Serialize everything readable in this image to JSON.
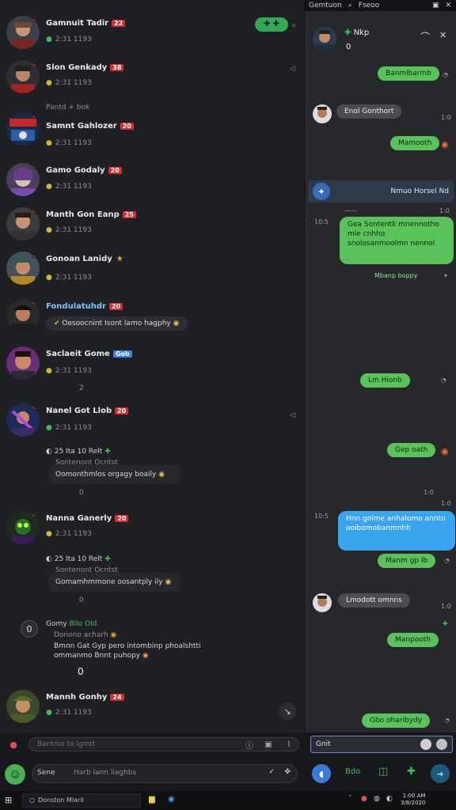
{
  "topbar": {
    "item1": "Gemtuon",
    "item2": "Fseoo"
  },
  "left_list": {
    "rows": [
      {
        "name": "Gamnuit Tadir",
        "badge": "22",
        "sub_icon": "●",
        "sub": "2:31  1193"
      },
      {
        "name": "Slon Genkady",
        "badge": "38",
        "sub_icon": "●",
        "sub": "2:31  1193"
      },
      {
        "name": "Samnt Gahlozer",
        "badge": "20",
        "pre": "Pantd + bok",
        "sub_icon": "●",
        "sub": "2:31  1193"
      },
      {
        "name": "Gamo Godaly",
        "badge": "20",
        "sub_icon": "●",
        "sub": "2:31  1193"
      },
      {
        "name": "Manth Gon Eanp",
        "badge": "25",
        "sub_icon": "●",
        "sub": "2:31  1193"
      },
      {
        "name": "Gonoan Lanidy",
        "sub_icon": "●",
        "sub": "2:31  1193"
      },
      {
        "name": "Fondulatuhdr",
        "badge": "20",
        "pill": "Oesoocnint Isont lamo hagphy"
      },
      {
        "name": "Saclaeit Gome",
        "badge_blue": "Gob",
        "sub_icon": "●",
        "sub": "2:31  1193",
        "extra": "2"
      },
      {
        "name": "Nanel Got Llob",
        "badge": "20",
        "sub_icon": "●",
        "sub": "2:31  1193"
      },
      {
        "name": "Nanna Ganerly",
        "badge": "20",
        "sub_icon": "●",
        "sub": "2:31  1193"
      },
      {
        "name": "Mannh Gonhy",
        "badge": "24",
        "sub_icon": "●",
        "sub": "2:31  1193"
      }
    ],
    "quote1": {
      "meta": "25 Ita 10 Relt",
      "sub": "Sontenont Ocntst",
      "text": "Oomonthmlos orgagy boaily"
    },
    "quote2": {
      "meta": "25 Ita 10 Relt",
      "sub": "Sontenont Ocntst",
      "text": "Gomamhmmone oosantply ily"
    },
    "note": {
      "label": "Gomy",
      "tag": "Bllo Old",
      "line1": "Donono acharh",
      "line2": "Bmnn Gat Gyp pero intombinp phoalshtti",
      "line3": "ommanmo Bnnt puhopy",
      "counter": "0"
    },
    "status_a": "0",
    "status_b": "0"
  },
  "right_chat": {
    "header_title": "Nkp",
    "header_sub": "0",
    "messages": [
      {
        "side": "out",
        "text": "Banmlbarmb"
      },
      {
        "side": "in",
        "text": "Enol Gonthort"
      },
      {
        "side": "out",
        "text": "Mamooth"
      },
      {
        "side": "out",
        "text": "Gea Sontentk mnennotho mle cnhho snolosanmoolmn nennol"
      },
      {
        "side": "out",
        "text": "Mbanp boppy"
      },
      {
        "side": "out",
        "text": "Lm Hionb"
      },
      {
        "side": "out",
        "text": "Gep oath"
      },
      {
        "side": "out",
        "text": "Hnn golme anhalomo annto ooibomobanmnhh"
      },
      {
        "side": "out",
        "text": "Manm gp Ib"
      },
      {
        "side": "in",
        "text": "Lmodott omnns"
      },
      {
        "side": "out",
        "text": "Manpooth"
      },
      {
        "side": "out",
        "text": "Gbo oharibydy"
      }
    ],
    "notice": "Nmuo Horsel Nd",
    "times": [
      "1:0",
      "10:5",
      "1:0",
      "1:0",
      "10:5",
      "1:0"
    ]
  },
  "bottom": {
    "left_input_placeholder": "Bantnio to lgmtt",
    "right_input_value": "Gnit",
    "composer_label": "Sene",
    "composer_placeholder": "Harb lann liaghbs",
    "right_btn_text": "Bdo"
  },
  "taskbar": {
    "search": "Donston Mlaril",
    "clock_time": "1:00 AM",
    "clock_date": "3/8/2020"
  },
  "colors": {
    "accent_green": "#59c25a",
    "accent_blue": "#3aa4ee",
    "badge_red": "#d32f2f"
  }
}
